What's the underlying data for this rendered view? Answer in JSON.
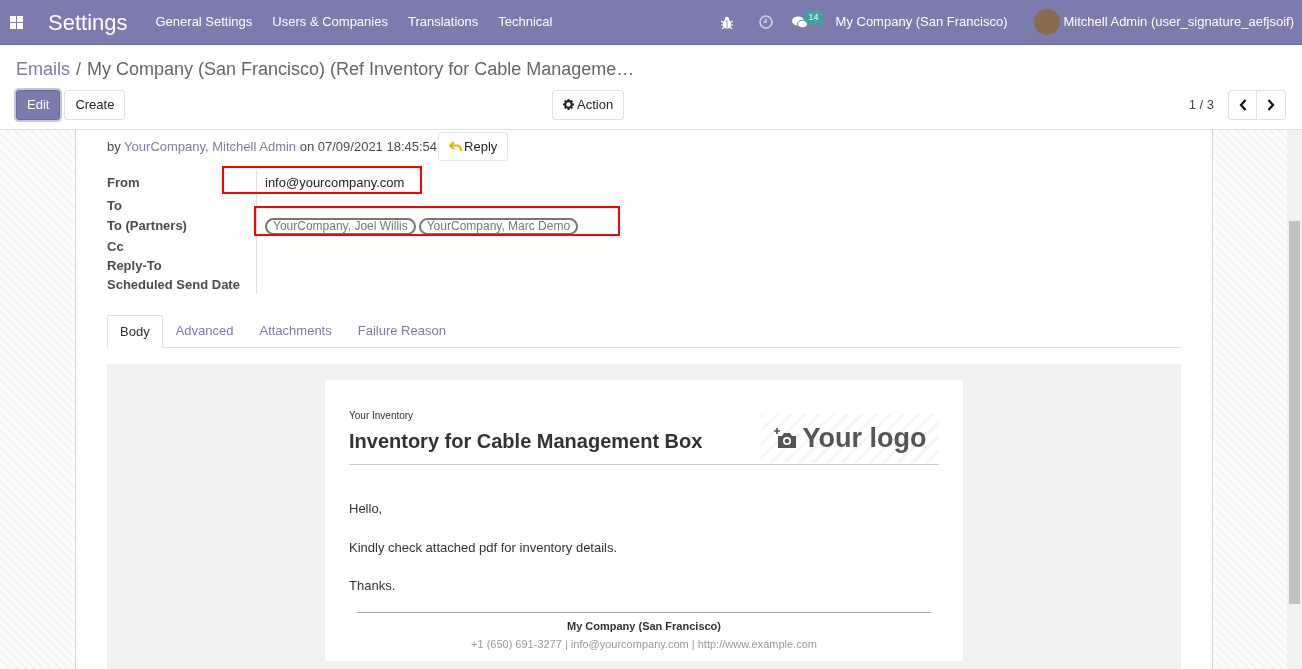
{
  "navbar": {
    "app_title": "Settings",
    "menu": [
      "General Settings",
      "Users & Companies",
      "Translations",
      "Technical"
    ],
    "messages_count": "14",
    "company": "My Company (San Francisco)",
    "user": "Mitchell Admin (user_signature_aefjsoif)"
  },
  "breadcrumb": {
    "parent": "Emails",
    "separator": "/",
    "current": "My Company (San Francisco) (Ref Inventory for Cable Manageme…"
  },
  "buttons": [
    {
      "label": "Edit",
      "kind": "primary"
    },
    {
      "label": "Create",
      "kind": "secondary"
    }
  ],
  "action_button": "Action",
  "pager": "1 / 3",
  "message": {
    "by_prefix": "by",
    "author": "YourCompany, Mitchell Admin",
    "date": "on 07/09/2021 18:45:54",
    "reply": "Reply"
  },
  "fields": [
    {
      "label": "From",
      "value": "info@yourcompany.com",
      "highlighted": true
    },
    {
      "label": "To"
    },
    {
      "label": "To (Partners)",
      "tags": [
        "YourCompany, Joel Willis",
        "YourCompany, Marc Demo"
      ],
      "highlighted": true
    },
    {
      "label": "Cc"
    },
    {
      "label": "Reply-To"
    },
    {
      "label": "Scheduled Send Date"
    }
  ],
  "tabs": [
    {
      "label": "Body",
      "selected": true
    },
    {
      "label": "Advanced",
      "selected": false
    },
    {
      "label": "Attachments",
      "selected": false
    },
    {
      "label": "Failure Reason",
      "selected": false
    }
  ],
  "email": {
    "kicker": "Your Inventory",
    "title": "Inventory for Cable Management Box",
    "logo": "Your logo",
    "paragraphs": [
      "Hello,",
      "Kindly check attached pdf for inventory details.",
      "Thanks."
    ],
    "footer_company": "My Company (San Francisco)",
    "footer_contact": "+1 (650) 691-3277 | info@yourcompany.com | http://www.example.com"
  }
}
